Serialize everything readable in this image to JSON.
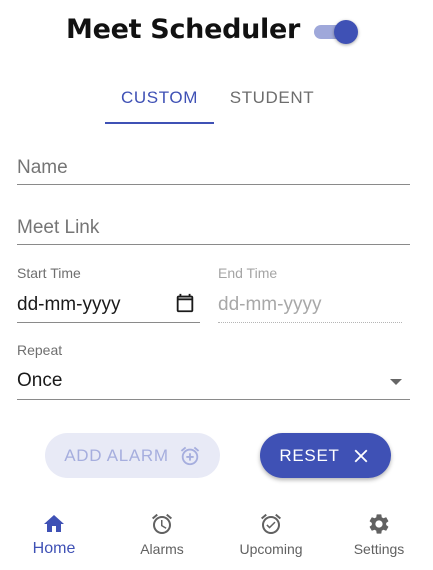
{
  "header": {
    "title": "Meet Scheduler",
    "toggle_on": true
  },
  "tabs": [
    {
      "label": "CUSTOM",
      "active": true
    },
    {
      "label": "STUDENT",
      "active": false
    }
  ],
  "form": {
    "name": {
      "placeholder": "Name",
      "value": ""
    },
    "meet_link": {
      "placeholder": "Meet Link",
      "value": ""
    },
    "start_time": {
      "label": "Start Time",
      "value": "dd-mm-yyyy",
      "icon": "calendar-icon"
    },
    "end_time": {
      "label": "End Time",
      "value": "dd-mm-yyyy",
      "disabled": true
    },
    "repeat": {
      "label": "Repeat",
      "value": "Once"
    }
  },
  "buttons": {
    "add_alarm": {
      "label": "ADD ALARM",
      "icon": "add-alarm-icon",
      "disabled": true
    },
    "reset": {
      "label": "RESET",
      "icon": "close-icon"
    }
  },
  "bottom_nav": [
    {
      "label": "Home",
      "icon": "home-icon",
      "active": true
    },
    {
      "label": "Alarms",
      "icon": "alarm-icon",
      "active": false
    },
    {
      "label": "Upcoming",
      "icon": "alarm-check-icon",
      "active": false
    },
    {
      "label": "Settings",
      "icon": "gear-icon",
      "active": false
    }
  ],
  "colors": {
    "primary": "#3f51b5",
    "primary_light": "#9fa8da",
    "disabled_bg": "#e8eaf6",
    "inactive": "#616161"
  }
}
